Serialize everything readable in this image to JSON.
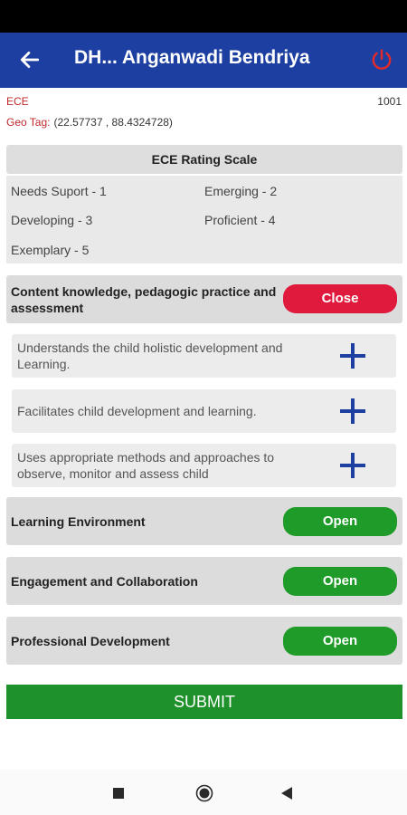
{
  "appbar": {
    "title": "DH... Anganwadi Bendriya",
    "back_icon": "arrow-left-icon",
    "power_icon": "power-icon"
  },
  "meta": {
    "program": "ECE",
    "id": "1001",
    "geo_label": "Geo Tag:",
    "geo_value": "(22.57737 , 88.4324728)"
  },
  "scale": {
    "title": "ECE Rating Scale",
    "items": [
      "Needs Suport - 1",
      "Emerging - 2",
      "Developing - 3",
      "Proficient - 4",
      "Exemplary - 5"
    ]
  },
  "sections": [
    {
      "title": "Content knowledge, pedagogic practice and assessment",
      "button": "Close",
      "subitems": [
        "Understands the child holistic development and Learning.",
        "Facilitates child development and learning.",
        "Uses appropriate methods and approaches to observe, monitor and assess child"
      ]
    },
    {
      "title": "Learning Environment",
      "button": "Open"
    },
    {
      "title": "Engagement and Collaboration",
      "button": "Open"
    },
    {
      "title": "Professional Development",
      "button": "Open"
    }
  ],
  "submit_label": "SUBMIT",
  "colors": {
    "appbar": "#1d3fa1",
    "close_button": "#e01a3c",
    "open_button": "#1e9b28",
    "submit_button": "#1f912a",
    "meta_label": "#c0282b",
    "plus_icon": "#1d3fa1"
  }
}
